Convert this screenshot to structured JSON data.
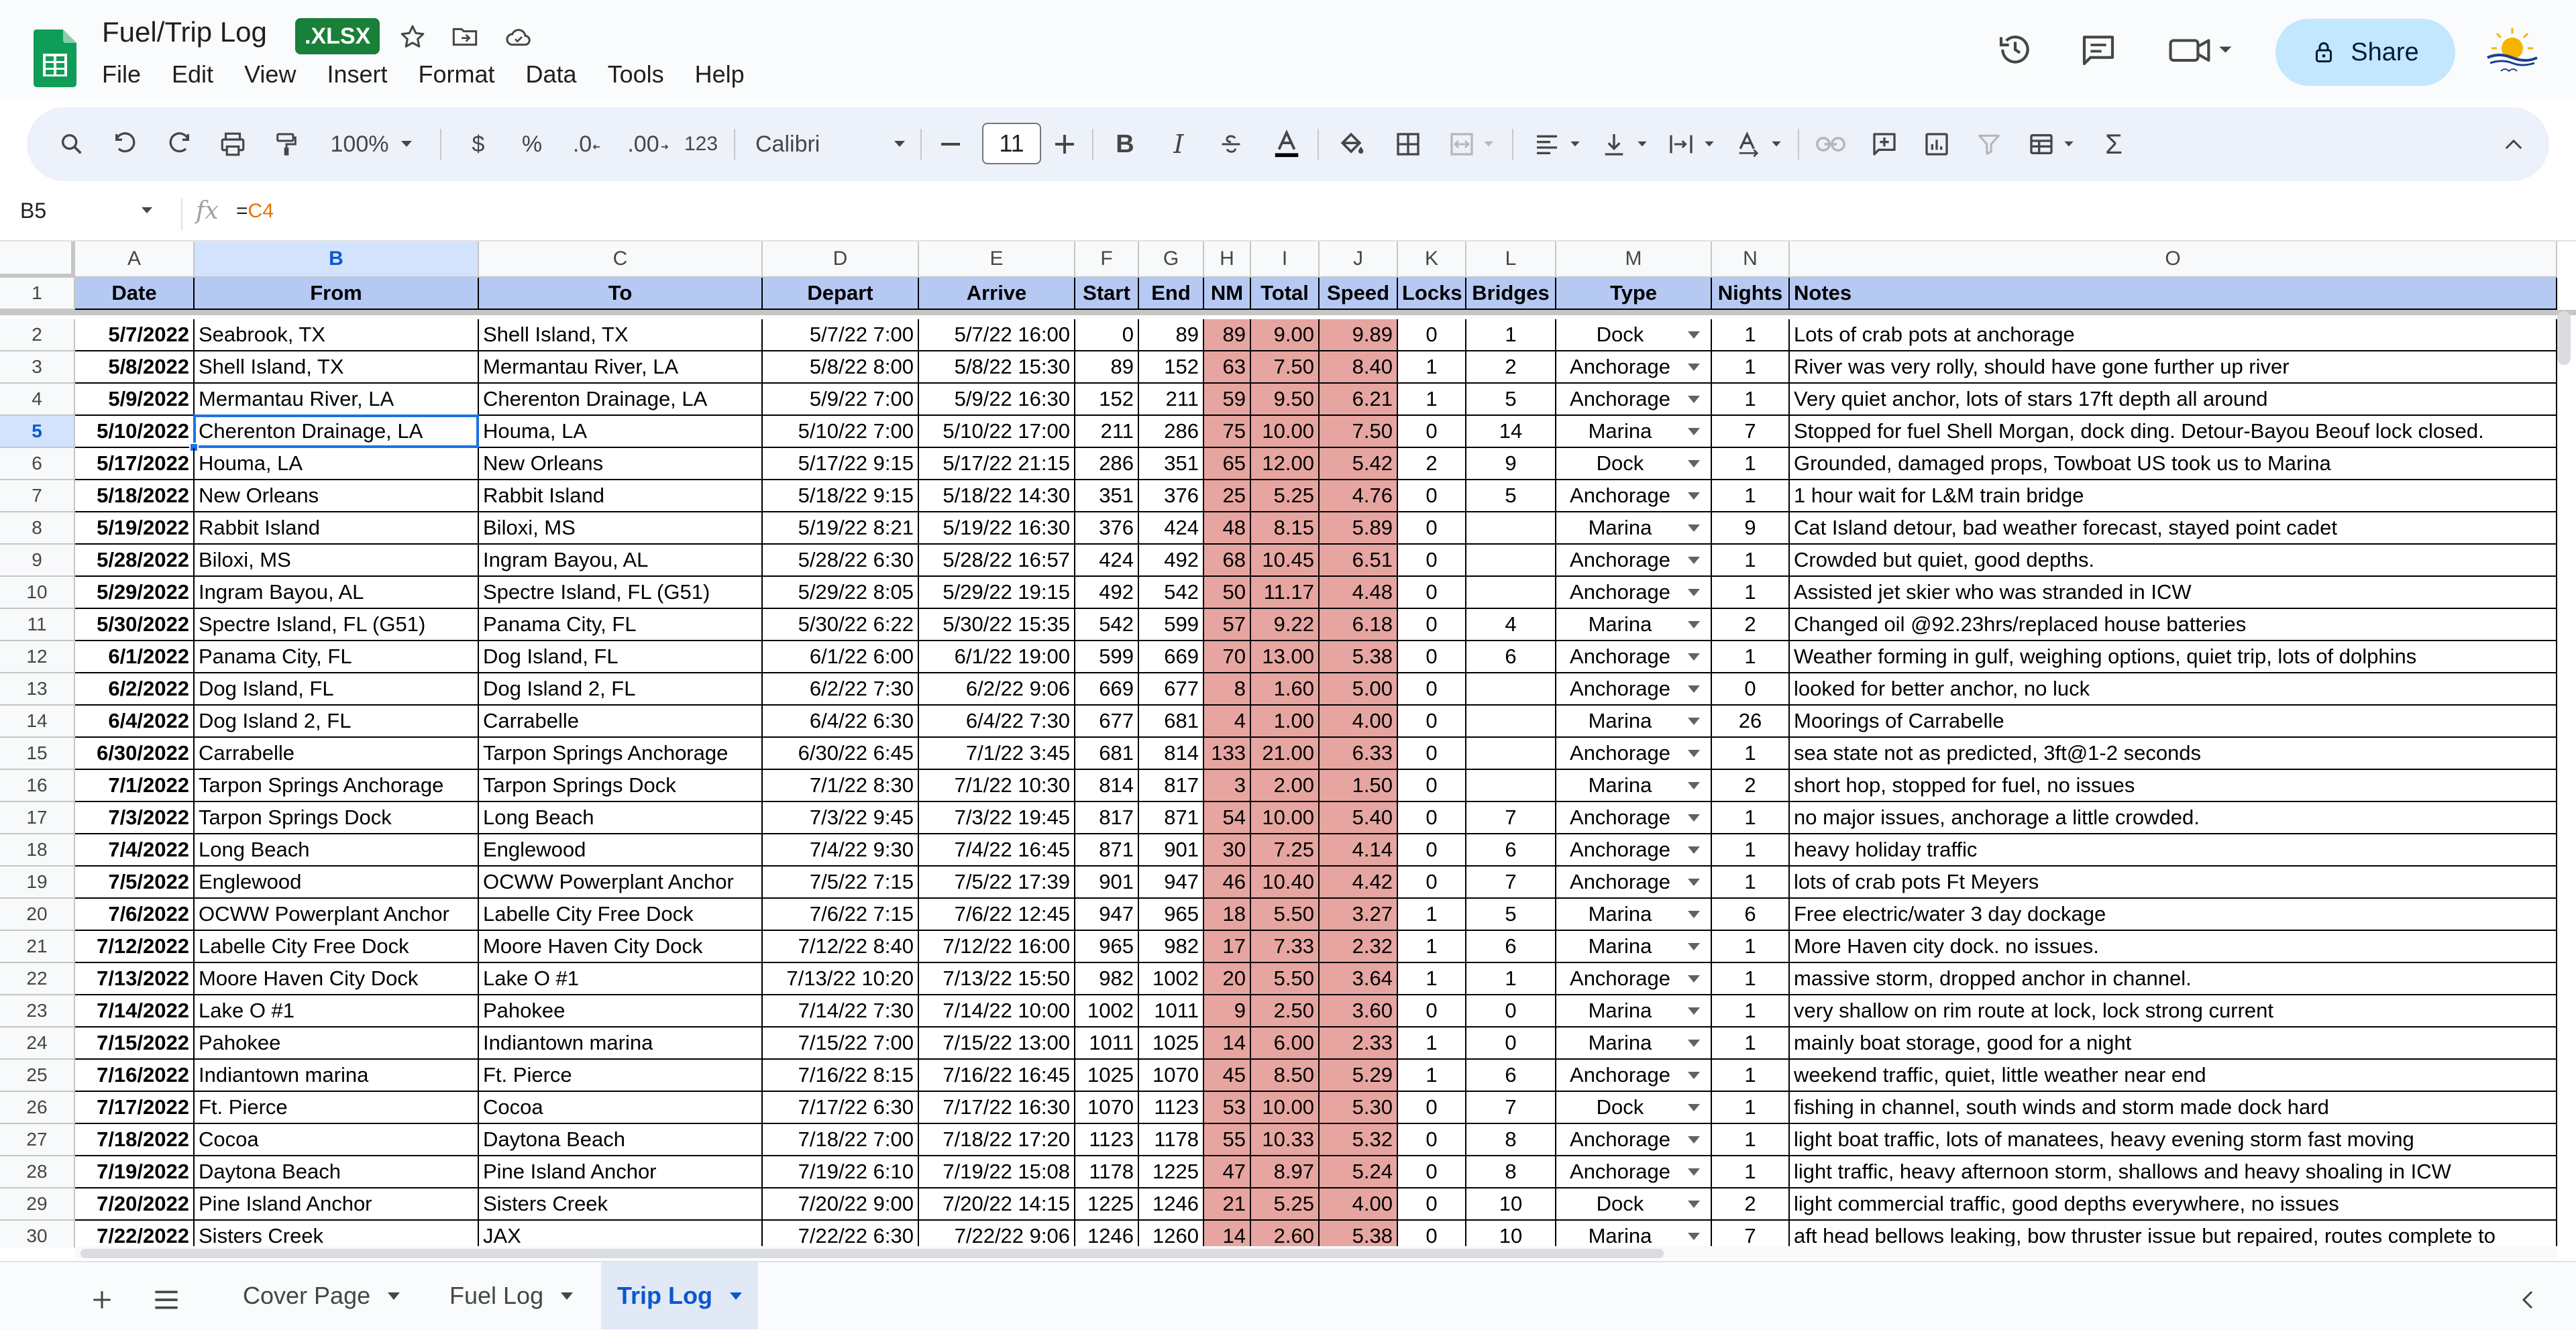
{
  "app": {
    "doc_title": "Fuel/Trip Log",
    "file_badge": ".XLSX",
    "share_label": "Share",
    "accent_color": "#0b57d0",
    "share_bg": "#c2e7ff"
  },
  "menu": [
    "File",
    "Edit",
    "View",
    "Insert",
    "Format",
    "Data",
    "Tools",
    "Help"
  ],
  "toolbar": {
    "zoom": "100%",
    "currency": "$",
    "percent": "%",
    "dec_decrease": ".0",
    "dec_increase": ".00",
    "number_format": "123",
    "font_name": "Calibri",
    "font_size": "11"
  },
  "formula_bar": {
    "name_box": "B5",
    "fx": "fx",
    "formula_prefix": "=",
    "formula_ref": "C4"
  },
  "grid": {
    "column_letters": [
      "A",
      "B",
      "C",
      "D",
      "E",
      "F",
      "G",
      "H",
      "I",
      "J",
      "K",
      "L",
      "M",
      "N",
      "O"
    ],
    "selected_column": "B",
    "selected_row": "5",
    "header_row_number": "1",
    "headers": [
      "Date",
      "From",
      "To",
      "Depart",
      "Arrive",
      "Start",
      "End",
      "NM",
      "Total",
      "Speed",
      "Locks",
      "Bridges",
      "Type",
      "Nights",
      "Notes"
    ],
    "header_color": "#b6c9f3",
    "highlight_color": "#e6a5a0",
    "rows": [
      {
        "n": "2",
        "c": [
          "5/7/2022",
          "Seabrook, TX",
          "Shell Island, TX",
          "5/7/22 7:00",
          "5/7/22 16:00",
          "0",
          "89",
          "89",
          "9.00",
          "9.89",
          "0",
          "1",
          "Dock",
          "1",
          "Lots of crab pots at anchorage"
        ]
      },
      {
        "n": "3",
        "c": [
          "5/8/2022",
          "Shell Island, TX",
          "Mermantau River, LA",
          "5/8/22 8:00",
          "5/8/22 15:30",
          "89",
          "152",
          "63",
          "7.50",
          "8.40",
          "1",
          "2",
          "Anchorage",
          "1",
          "River was very rolly, should have gone further up river"
        ]
      },
      {
        "n": "4",
        "c": [
          "5/9/2022",
          "Mermantau River, LA",
          "Cherenton Drainage, LA",
          "5/9/22 7:00",
          "5/9/22 16:30",
          "152",
          "211",
          "59",
          "9.50",
          "6.21",
          "1",
          "5",
          "Anchorage",
          "1",
          "Very quiet anchor, lots of stars 17ft depth all around"
        ]
      },
      {
        "n": "5",
        "c": [
          "5/10/2022",
          "Cherenton Drainage, LA",
          "Houma, LA",
          "5/10/22 7:00",
          "5/10/22 17:00",
          "211",
          "286",
          "75",
          "10.00",
          "7.50",
          "0",
          "14",
          "Marina",
          "7",
          "Stopped for fuel Shell Morgan, dock ding. Detour-Bayou Beouf lock closed."
        ]
      },
      {
        "n": "6",
        "c": [
          "5/17/2022",
          "Houma, LA",
          "New Orleans",
          "5/17/22 9:15",
          "5/17/22 21:15",
          "286",
          "351",
          "65",
          "12.00",
          "5.42",
          "2",
          "9",
          "Dock",
          "1",
          "Grounded, damaged props, Towboat US took us to Marina"
        ]
      },
      {
        "n": "7",
        "c": [
          "5/18/2022",
          "New Orleans",
          "Rabbit Island",
          "5/18/22 9:15",
          "5/18/22 14:30",
          "351",
          "376",
          "25",
          "5.25",
          "4.76",
          "0",
          "5",
          "Anchorage",
          "1",
          "1 hour wait for L&M train bridge"
        ]
      },
      {
        "n": "8",
        "c": [
          "5/19/2022",
          "Rabbit Island",
          "Biloxi, MS",
          "5/19/22 8:21",
          "5/19/22 16:30",
          "376",
          "424",
          "48",
          "8.15",
          "5.89",
          "0",
          "",
          "Marina",
          "9",
          "Cat Island detour, bad weather forecast, stayed point cadet"
        ]
      },
      {
        "n": "9",
        "c": [
          "5/28/2022",
          "Biloxi, MS",
          "Ingram Bayou, AL",
          "5/28/22 6:30",
          "5/28/22 16:57",
          "424",
          "492",
          "68",
          "10.45",
          "6.51",
          "0",
          "",
          "Anchorage",
          "1",
          "Crowded but quiet, good depths."
        ]
      },
      {
        "n": "10",
        "c": [
          "5/29/2022",
          "Ingram Bayou, AL",
          "Spectre Island, FL (G51)",
          "5/29/22 8:05",
          "5/29/22 19:15",
          "492",
          "542",
          "50",
          "11.17",
          "4.48",
          "0",
          "",
          "Anchorage",
          "1",
          "Assisted jet skier who was stranded in ICW"
        ]
      },
      {
        "n": "11",
        "c": [
          "5/30/2022",
          "Spectre Island, FL (G51)",
          "Panama City, FL",
          "5/30/22 6:22",
          "5/30/22 15:35",
          "542",
          "599",
          "57",
          "9.22",
          "6.18",
          "0",
          "4",
          "Marina",
          "2",
          "Changed oil @92.23hrs/replaced house batteries"
        ]
      },
      {
        "n": "12",
        "c": [
          "6/1/2022",
          "Panama City, FL",
          "Dog Island, FL",
          "6/1/22 6:00",
          "6/1/22 19:00",
          "599",
          "669",
          "70",
          "13.00",
          "5.38",
          "0",
          "6",
          "Anchorage",
          "1",
          "Weather forming in gulf, weighing options, quiet trip, lots of dolphins"
        ]
      },
      {
        "n": "13",
        "c": [
          "6/2/2022",
          "Dog Island, FL",
          "Dog Island 2, FL",
          "6/2/22 7:30",
          "6/2/22 9:06",
          "669",
          "677",
          "8",
          "1.60",
          "5.00",
          "0",
          "",
          "Anchorage",
          "0",
          "looked for better anchor, no luck"
        ]
      },
      {
        "n": "14",
        "c": [
          "6/4/2022",
          "Dog Island 2, FL",
          "Carrabelle",
          "6/4/22 6:30",
          "6/4/22 7:30",
          "677",
          "681",
          "4",
          "1.00",
          "4.00",
          "0",
          "",
          "Marina",
          "26",
          "Moorings of Carrabelle"
        ]
      },
      {
        "n": "15",
        "c": [
          "6/30/2022",
          "Carrabelle",
          "Tarpon Springs Anchorage",
          "6/30/22 6:45",
          "7/1/22 3:45",
          "681",
          "814",
          "133",
          "21.00",
          "6.33",
          "0",
          "",
          "Anchorage",
          "1",
          "sea state not as predicted, 3ft@1-2 seconds"
        ]
      },
      {
        "n": "16",
        "c": [
          "7/1/2022",
          "Tarpon Springs Anchorage",
          "Tarpon Springs Dock",
          "7/1/22 8:30",
          "7/1/22 10:30",
          "814",
          "817",
          "3",
          "2.00",
          "1.50",
          "0",
          "",
          "Marina",
          "2",
          "short hop, stopped for fuel, no issues"
        ]
      },
      {
        "n": "17",
        "c": [
          "7/3/2022",
          "Tarpon Springs Dock",
          "Long Beach",
          "7/3/22 9:45",
          "7/3/22 19:45",
          "817",
          "871",
          "54",
          "10.00",
          "5.40",
          "0",
          "7",
          "Anchorage",
          "1",
          "no major issues, anchorage a little crowded."
        ]
      },
      {
        "n": "18",
        "c": [
          "7/4/2022",
          "Long Beach",
          "Englewood",
          "7/4/22 9:30",
          "7/4/22 16:45",
          "871",
          "901",
          "30",
          "7.25",
          "4.14",
          "0",
          "6",
          "Anchorage",
          "1",
          "heavy holiday traffic"
        ]
      },
      {
        "n": "19",
        "c": [
          "7/5/2022",
          "Englewood",
          "OCWW Powerplant Anchor",
          "7/5/22 7:15",
          "7/5/22 17:39",
          "901",
          "947",
          "46",
          "10.40",
          "4.42",
          "0",
          "7",
          "Anchorage",
          "1",
          "lots of crab pots Ft Meyers"
        ]
      },
      {
        "n": "20",
        "c": [
          "7/6/2022",
          "OCWW Powerplant Anchor",
          "Labelle City Free Dock",
          "7/6/22 7:15",
          "7/6/22 12:45",
          "947",
          "965",
          "18",
          "5.50",
          "3.27",
          "1",
          "5",
          "Marina",
          "6",
          "Free electric/water 3 day dockage"
        ]
      },
      {
        "n": "21",
        "c": [
          "7/12/2022",
          "Labelle City Free Dock",
          "Moore Haven City Dock",
          "7/12/22 8:40",
          "7/12/22 16:00",
          "965",
          "982",
          "17",
          "7.33",
          "2.32",
          "1",
          "6",
          "Marina",
          "1",
          "More Haven city dock. no issues."
        ]
      },
      {
        "n": "22",
        "c": [
          "7/13/2022",
          "Moore Haven City Dock",
          "Lake O #1",
          "7/13/22 10:20",
          "7/13/22 15:50",
          "982",
          "1002",
          "20",
          "5.50",
          "3.64",
          "1",
          "1",
          "Anchorage",
          "1",
          "massive storm, dropped anchor in channel."
        ]
      },
      {
        "n": "23",
        "c": [
          "7/14/2022",
          "Lake O #1",
          "Pahokee",
          "7/14/22 7:30",
          "7/14/22 10:00",
          "1002",
          "1011",
          "9",
          "2.50",
          "3.60",
          "0",
          "0",
          "Marina",
          "1",
          "very shallow on rim route at lock, lock strong current"
        ]
      },
      {
        "n": "24",
        "c": [
          "7/15/2022",
          "Pahokee",
          "Indiantown marina",
          "7/15/22 7:00",
          "7/15/22 13:00",
          "1011",
          "1025",
          "14",
          "6.00",
          "2.33",
          "1",
          "0",
          "Marina",
          "1",
          "mainly boat storage, good for a night"
        ]
      },
      {
        "n": "25",
        "c": [
          "7/16/2022",
          "Indiantown marina",
          "Ft. Pierce",
          "7/16/22 8:15",
          "7/16/22 16:45",
          "1025",
          "1070",
          "45",
          "8.50",
          "5.29",
          "1",
          "6",
          "Anchorage",
          "1",
          "weekend traffic, quiet, little weather near end"
        ]
      },
      {
        "n": "26",
        "c": [
          "7/17/2022",
          "Ft. Pierce",
          "Cocoa",
          "7/17/22 6:30",
          "7/17/22 16:30",
          "1070",
          "1123",
          "53",
          "10.00",
          "5.30",
          "0",
          "7",
          "Dock",
          "1",
          "fishing in channel, south winds and storm made dock hard"
        ]
      },
      {
        "n": "27",
        "c": [
          "7/18/2022",
          "Cocoa",
          "Daytona Beach",
          "7/18/22 7:00",
          "7/18/22 17:20",
          "1123",
          "1178",
          "55",
          "10.33",
          "5.32",
          "0",
          "8",
          "Anchorage",
          "1",
          "light boat traffic, lots of manatees, heavy evening storm fast moving"
        ]
      },
      {
        "n": "28",
        "c": [
          "7/19/2022",
          "Daytona Beach",
          "Pine Island Anchor",
          "7/19/22 6:10",
          "7/19/22 15:08",
          "1178",
          "1225",
          "47",
          "8.97",
          "5.24",
          "0",
          "8",
          "Anchorage",
          "1",
          "light traffic, heavy afternoon storm, shallows and heavy shoaling in ICW"
        ]
      },
      {
        "n": "29",
        "c": [
          "7/20/2022",
          "Pine Island Anchor",
          "Sisters Creek",
          "7/20/22 9:00",
          "7/20/22 14:15",
          "1225",
          "1246",
          "21",
          "5.25",
          "4.00",
          "0",
          "10",
          "Dock",
          "2",
          "light commercial traffic, good depths everywhere, no issues"
        ]
      },
      {
        "n": "30",
        "c": [
          "7/22/2022",
          "Sisters Creek",
          "JAX",
          "7/22/22 6:30",
          "7/22/22 9:06",
          "1246",
          "1260",
          "14",
          "2.60",
          "5.38",
          "0",
          "10",
          "Marina",
          "7",
          "aft head bellows leaking, bow thruster issue but repaired, routes complete to"
        ]
      }
    ]
  },
  "sheets": {
    "tabs": [
      "Cover Page",
      "Fuel Log",
      "Trip Log"
    ],
    "active": "Trip Log"
  }
}
